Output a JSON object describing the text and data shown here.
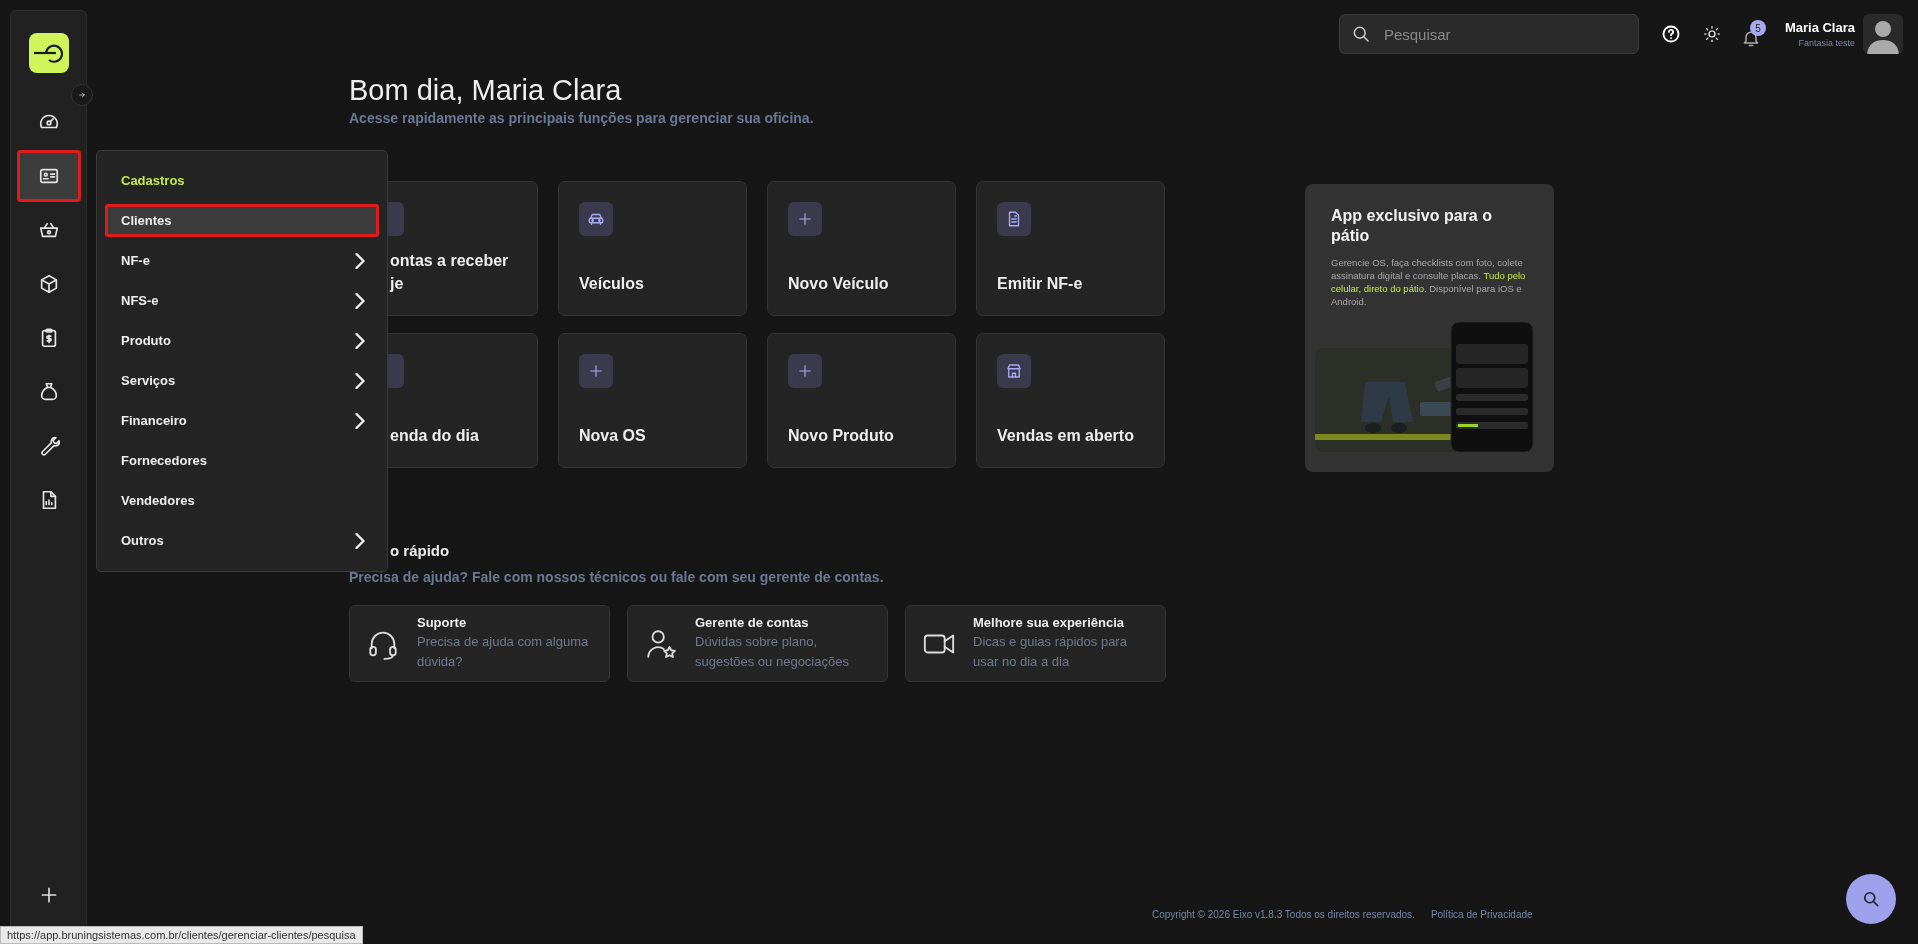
{
  "sidebar": {
    "items": [
      {
        "selected": false,
        "outlined": false
      },
      {
        "selected": true,
        "outlined": true
      },
      {
        "selected": false,
        "outlined": false
      },
      {
        "selected": false,
        "outlined": false
      },
      {
        "selected": false,
        "outlined": false
      },
      {
        "selected": false,
        "outlined": false
      },
      {
        "selected": false,
        "outlined": false
      },
      {
        "selected": false,
        "outlined": false
      }
    ]
  },
  "menu": {
    "title": "Cadastros",
    "items": [
      {
        "label": "Clientes",
        "selected": true,
        "outlined": true,
        "submenu": false
      },
      {
        "label": "NF-e",
        "selected": false,
        "outlined": false,
        "submenu": true
      },
      {
        "label": "NFS-e",
        "selected": false,
        "outlined": false,
        "submenu": true
      },
      {
        "label": "Produto",
        "selected": false,
        "outlined": false,
        "submenu": true
      },
      {
        "label": "Serviços",
        "selected": false,
        "outlined": false,
        "submenu": true
      },
      {
        "label": "Financeiro",
        "selected": false,
        "outlined": false,
        "submenu": true
      },
      {
        "label": "Fornecedores",
        "selected": false,
        "outlined": false,
        "submenu": false
      },
      {
        "label": "Vendedores",
        "selected": false,
        "outlined": false,
        "submenu": false
      },
      {
        "label": "Outros",
        "selected": false,
        "outlined": false,
        "submenu": true
      }
    ]
  },
  "header": {
    "search": {
      "placeholder": "Pesquisar"
    },
    "notifications": "5",
    "user": {
      "name": "Maria Clara",
      "company": "Fantasia teste"
    }
  },
  "greeting": {
    "title": "Bom dia, Maria Clara",
    "subtitle": "Acesse rapidamente as principais funções para gerenciar sua oficina."
  },
  "shortcuts": [
    {
      "lines": [
        "ontas a receber",
        "je"
      ]
    },
    {
      "lines": [
        "Veículos"
      ]
    },
    {
      "lines": [
        "Novo Veículo"
      ]
    },
    {
      "lines": [
        "Emitir NF-e"
      ]
    },
    {
      "lines": [
        "enda do dia"
      ]
    },
    {
      "lines": [
        "Nova OS"
      ]
    },
    {
      "lines": [
        "Novo Produto"
      ]
    },
    {
      "lines": [
        "Vendas em aberto"
      ]
    }
  ],
  "promo": {
    "title": "App exclusivo para o pátio",
    "text": "Gerencie OS, faça checklists com foto, colete assinatura digital e consulte placas. **Tudo pelo celular, direto do pátio.** Disponível para iOS e Android.",
    "kind": "picture"
  },
  "contact": {
    "title": "o rápido",
    "subtitle": "Precisa de ajuda? Fale com nossos técnicos ou fale com seu gerente de contas.",
    "cards": [
      {
        "title": "Suporte",
        "text": "Precisa de ajuda com alguma dúvida?"
      },
      {
        "title": "Gerente de contas",
        "text": "Dúvidas sobre plano, sugestões ou negociações"
      },
      {
        "title": "Melhore sua experiência",
        "text": "Dicas e guias rápidos para usar no dia a dia"
      }
    ]
  },
  "footer": {
    "copyright": "Copyright © 2026 Eixo v1.8.3 Todos os direitos reservados.",
    "privacy": "Política de Privacidade"
  },
  "status_url": "https://app.bruningsistemas.com.br/clientes/gerenciar-clientes/pesquisa"
}
